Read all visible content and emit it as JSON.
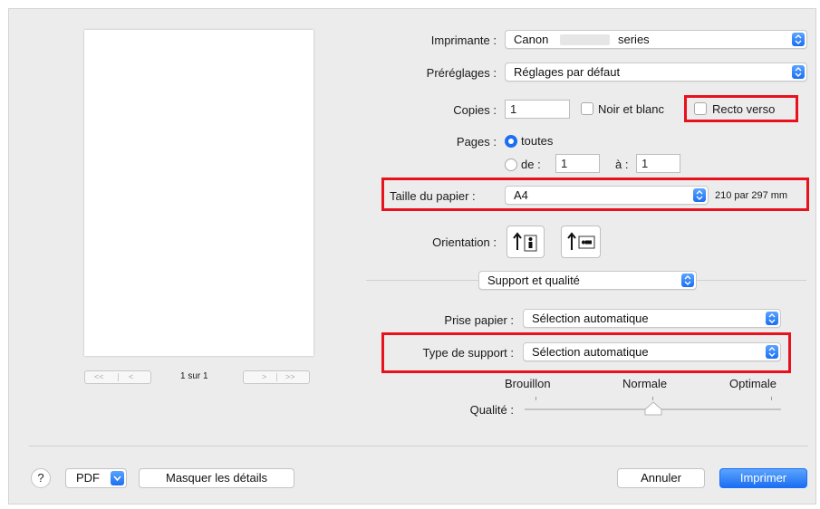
{
  "printer": {
    "label": "Imprimante :",
    "value_prefix": "Canon",
    "value_suffix": "series"
  },
  "presets": {
    "label": "Préréglages :",
    "value": "Réglages par défaut"
  },
  "copies": {
    "label": "Copies :",
    "value": "1"
  },
  "bw": {
    "label": "Noir et blanc"
  },
  "duplex": {
    "label": "Recto verso"
  },
  "pages": {
    "label": "Pages :",
    "all": "toutes",
    "from_label": "de :",
    "from_value": "1",
    "to_label": "à :",
    "to_value": "1"
  },
  "paper_size": {
    "label": "Taille du papier :",
    "value": "A4",
    "dims": "210 par 297 mm"
  },
  "orientation": {
    "label": "Orientation :"
  },
  "section": {
    "value": "Support et qualité"
  },
  "paper_source": {
    "label": "Prise papier :",
    "value": "Sélection automatique"
  },
  "media_type": {
    "label": "Type de support :",
    "value": "Sélection automatique"
  },
  "quality": {
    "label": "Qualité :",
    "draft": "Brouillon",
    "normal": "Normale",
    "best": "Optimale",
    "level": 0.5
  },
  "preview": {
    "page_indicator": "1 sur 1",
    "first": "<<",
    "prev": "<",
    "next": ">",
    "last": ">>"
  },
  "footer": {
    "help": "?",
    "pdf": "PDF",
    "hide_details": "Masquer les détails",
    "cancel": "Annuler",
    "print": "Imprimer"
  },
  "colors": {
    "accent": "#1c6ef2",
    "highlight": "#e8121c"
  }
}
